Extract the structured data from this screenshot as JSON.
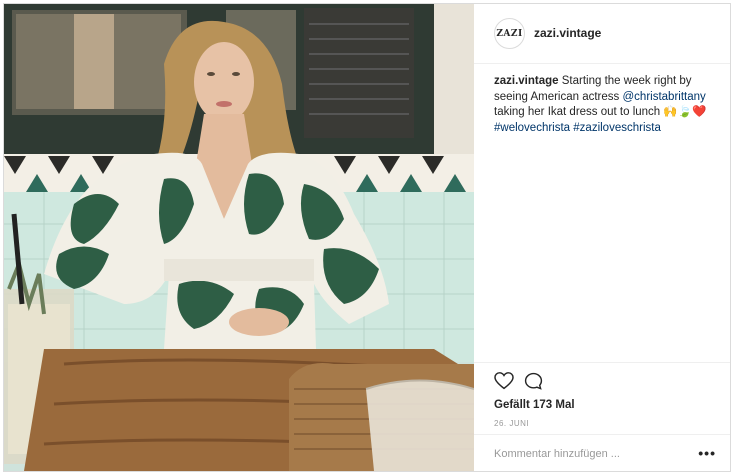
{
  "post": {
    "username": "zazi.vintage",
    "avatar_text": "ZAZI",
    "caption": {
      "username": "zazi.vintage",
      "text_1": "Starting the week right by seeing American actress",
      "mention": "@christabrittany",
      "text_2": "taking her Ikat dress out to lunch 🙌🍃❤️",
      "hashtag_1": "#welovechrista",
      "hashtag_2": "#zaziloveschrista"
    },
    "likes": "Gefällt 173 Mal",
    "date": "26. JUNI",
    "comment_placeholder": "Kommentar hinzufügen ...",
    "more_label": "•••"
  },
  "icons": {
    "like": "heart-icon",
    "comment": "comment-icon",
    "more": "more-options-icon"
  },
  "colors": {
    "text": "#262626",
    "link": "#003569",
    "muted": "#999999",
    "border": "#efefef"
  }
}
